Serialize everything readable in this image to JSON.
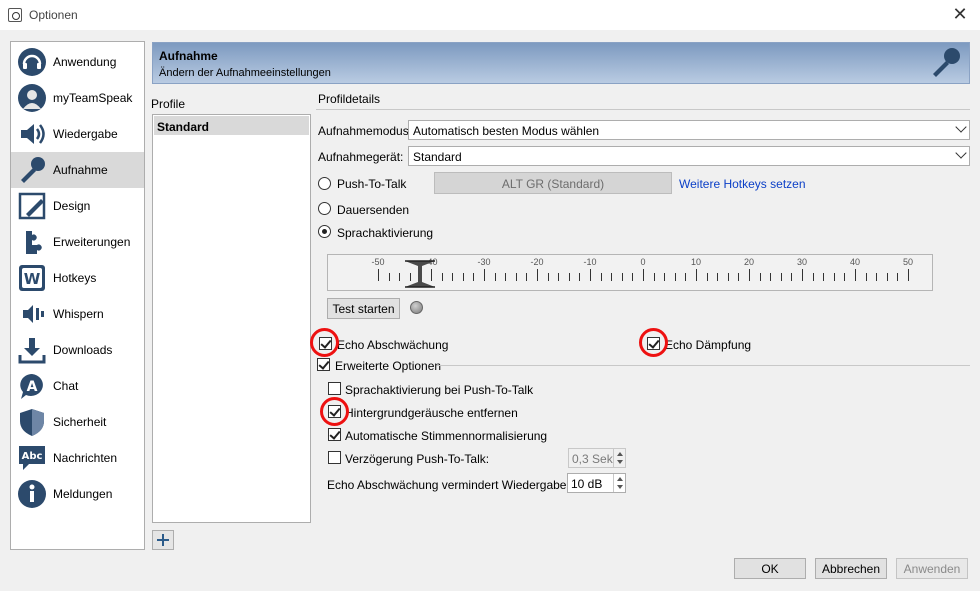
{
  "window": {
    "title": "Optionen"
  },
  "sidebar": {
    "items": [
      {
        "label": "Anwendung",
        "icon": "headset-icon"
      },
      {
        "label": "myTeamSpeak",
        "icon": "user-icon"
      },
      {
        "label": "Wiedergabe",
        "icon": "speaker-icon"
      },
      {
        "label": "Aufnahme",
        "icon": "microphone-icon",
        "active": true
      },
      {
        "label": "Design",
        "icon": "design-icon"
      },
      {
        "label": "Erweiterungen",
        "icon": "puzzle-icon"
      },
      {
        "label": "Hotkeys",
        "icon": "hotkeys-w-icon"
      },
      {
        "label": "Whispern",
        "icon": "whisper-icon"
      },
      {
        "label": "Downloads",
        "icon": "download-icon"
      },
      {
        "label": "Chat",
        "icon": "chat-icon"
      },
      {
        "label": "Sicherheit",
        "icon": "shield-icon"
      },
      {
        "label": "Nachrichten",
        "icon": "abc-message-icon"
      },
      {
        "label": "Meldungen",
        "icon": "info-icon"
      }
    ]
  },
  "header": {
    "title": "Aufnahme",
    "subtitle": "Ändern der Aufnahmeeinstellungen",
    "icon": "microphone-icon"
  },
  "profiles": {
    "label": "Profile",
    "items": [
      "Standard"
    ],
    "selected": "Standard"
  },
  "details": {
    "label": "Profildetails",
    "mode_label": "Aufnahmemodus:",
    "mode_value": "Automatisch besten Modus wählen",
    "device_label": "Aufnahmegerät:",
    "device_value": "Standard",
    "ptt_label": "Push-To-Talk",
    "hotkey_value": "ALT GR (Standard)",
    "more_hotkeys_link": "Weitere Hotkeys setzen",
    "continuous_label": "Dauersenden",
    "voice_activation_label": "Sprachaktivierung",
    "selected_mode": "Sprachaktivierung",
    "meter": {
      "ticks": [
        "-50",
        "-40",
        "-30",
        "-20",
        "-10",
        "0",
        "10",
        "20",
        "30",
        "40",
        "50"
      ],
      "threshold": -42
    },
    "test_button": "Test starten",
    "echo_cancel": {
      "label": "Echo Abschwächung",
      "checked": true
    },
    "echo_damp": {
      "label": "Echo Dämpfung",
      "checked": true
    },
    "advanced": {
      "label": "Erweiterte Optionen",
      "checked": true
    },
    "opt_voice_ptt": {
      "label": "Sprachaktivierung bei Push-To-Talk",
      "checked": false
    },
    "opt_denoise": {
      "label": "Hintergrundgeräusche entfernen",
      "checked": true
    },
    "opt_normalize": {
      "label": "Automatische Stimmennormalisierung",
      "checked": true
    },
    "opt_delay": {
      "label": "Verzögerung Push-To-Talk:",
      "checked": false,
      "value": "0,3 Sek"
    },
    "echo_reduce_label": "Echo Abschwächung vermindert Wiedergabe um:",
    "echo_reduce_value": "10 dB"
  },
  "footer": {
    "ok": "OK",
    "cancel": "Abbrechen",
    "apply": "Anwenden"
  },
  "colors": {
    "highlight_ring": "#e11111",
    "link": "#0b3fc7",
    "header_gradient_start": "#7d9ac0"
  }
}
